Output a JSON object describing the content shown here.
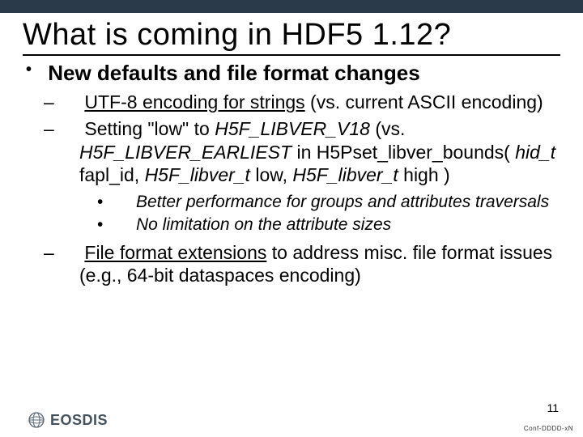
{
  "title": "What is coming in HDF5 1.12?",
  "bullet1": "New defaults and file format changes",
  "sub1_a": "UTF-8 encoding for strings",
  "sub1_b": " (vs. current ASCII encoding)",
  "sub2_a": "Setting \"low\" to ",
  "sub2_b": "H5F_LIBVER_V18",
  "sub2_c": "  (vs. ",
  "sub2_d": "H5F_LIBVER_EARLIEST",
  "sub2_e": " in H5Pset_libver_bounds( ",
  "sub2_f": "hid_t",
  "sub2_g": " fapl_id, ",
  "sub2_h": "H5F_libver_t",
  "sub2_i": " low, ",
  "sub2_j": "H5F_libver_t",
  "sub2_k": " high )",
  "subsub1": "Better performance for groups and attributes traversals",
  "subsub2": "No limitation on the attribute sizes",
  "sub3_a": "File format extensions",
  "sub3_b": " to address misc. file format issues (e.g., 64-bit dataspaces encoding)",
  "logo_text": "EOSDIS",
  "page_number": "11",
  "confidential": "Conf-DDDD-xN"
}
